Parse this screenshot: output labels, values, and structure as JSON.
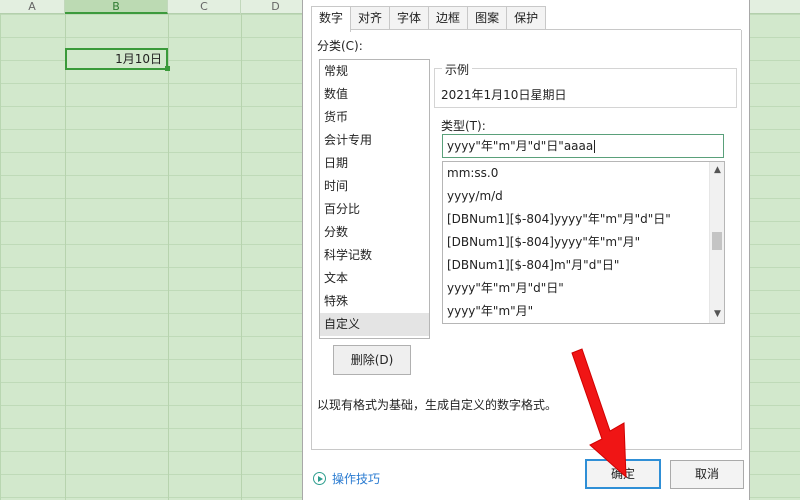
{
  "sheet": {
    "columns": [
      "A",
      "B",
      "C",
      "D"
    ],
    "selected_cell_value": "1月10日"
  },
  "dialog": {
    "tabs": [
      "数字",
      "对齐",
      "字体",
      "边框",
      "图案",
      "保护"
    ],
    "active_tab": "数字",
    "category_label": "分类(C):",
    "categories": [
      "常规",
      "数值",
      "货币",
      "会计专用",
      "日期",
      "时间",
      "百分比",
      "分数",
      "科学记数",
      "文本",
      "特殊",
      "自定义"
    ],
    "selected_category": "自定义",
    "sample_label": "示例",
    "sample_value": "2021年1月10日星期日",
    "type_label": "类型(T):",
    "type_value": "yyyy\"年\"m\"月\"d\"日\"aaaa",
    "format_list": [
      "mm:ss.0",
      "yyyy/m/d",
      "[DBNum1][$-804]yyyy\"年\"m\"月\"d\"日\"",
      "[DBNum1][$-804]yyyy\"年\"m\"月\"",
      "[DBNum1][$-804]m\"月\"d\"日\"",
      "yyyy\"年\"m\"月\"d\"日\"",
      "yyyy\"年\"m\"月\""
    ],
    "delete_label": "删除(D)",
    "hint": "以现有格式为基础，生成自定义的数字格式。",
    "tips_link": "操作技巧",
    "ok_label": "确定",
    "cancel_label": "取消"
  },
  "colors": {
    "sheet_bg": "#d2e8cc",
    "selection_green": "#3a9a3a",
    "link_blue": "#2a7bd1",
    "focus_blue": "#2f8fd6",
    "arrow_red": "#f01515"
  },
  "icons": [
    "play-circle-icon",
    "scroll-up-icon",
    "scroll-down-icon",
    "red-arrow-annotation"
  ]
}
